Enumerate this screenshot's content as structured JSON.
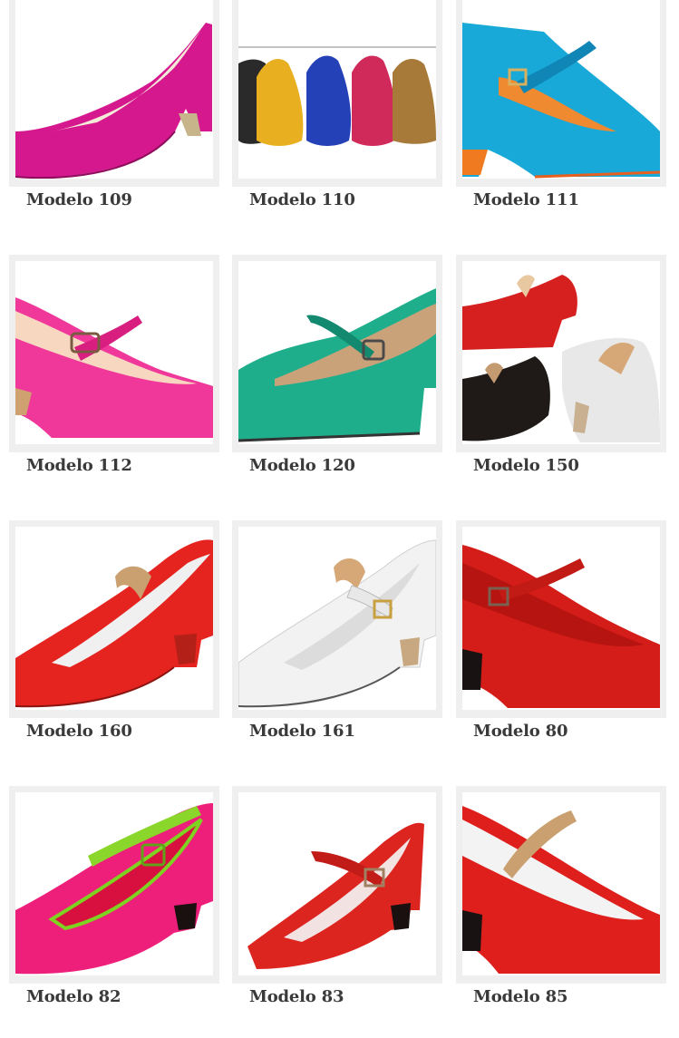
{
  "products": [
    {
      "name": "Modelo 109",
      "image": "pink-court-shoe",
      "color": "#d6188f"
    },
    {
      "name": "Modelo 110",
      "image": "multicolor-shoes-row",
      "color": "#e8b020"
    },
    {
      "name": "Modelo 111",
      "image": "turquoise-strap-shoe",
      "color": "#19a9d8"
    },
    {
      "name": "Modelo 112",
      "image": "pink-strap-shoe",
      "color": "#f0379a"
    },
    {
      "name": "Modelo 120",
      "image": "green-strap-shoe",
      "color": "#1fae8c"
    },
    {
      "name": "Modelo 150",
      "image": "red-black-white-elastic-shoes",
      "color": "#d62020"
    },
    {
      "name": "Modelo 160",
      "image": "red-elastic-shoe",
      "color": "#e5231f"
    },
    {
      "name": "Modelo 161",
      "image": "white-strap-shoe",
      "color": "#f2f2f2"
    },
    {
      "name": "Modelo 80",
      "image": "red-strap-shoe",
      "color": "#d41c18"
    },
    {
      "name": "Modelo 82",
      "image": "pink-green-strap-shoe",
      "color": "#ee1f7a"
    },
    {
      "name": "Modelo 83",
      "image": "red-strap-shoe",
      "color": "#dd2520"
    },
    {
      "name": "Modelo 85",
      "image": "red-elastic-shoe",
      "color": "#de1f1c"
    }
  ]
}
